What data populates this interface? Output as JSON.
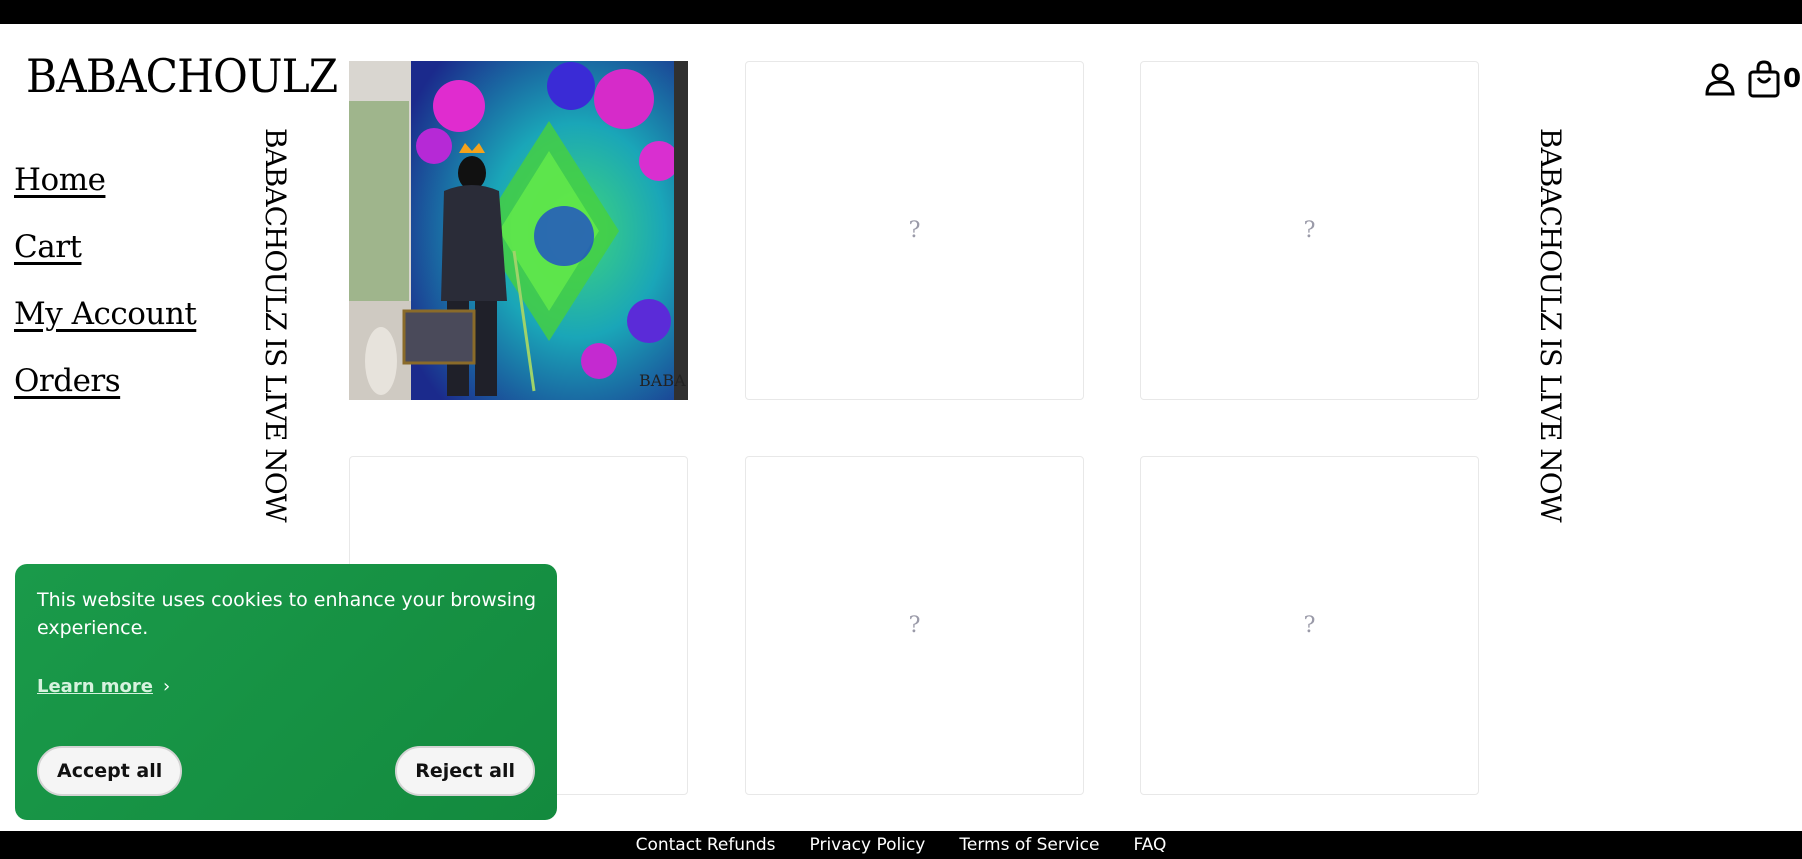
{
  "brand": {
    "logo_text": "BABACHOULZ"
  },
  "nav": {
    "items": [
      "Home",
      "Cart",
      "My Account",
      "Orders"
    ]
  },
  "marquee": {
    "text": "BABACHOULZ IS LIVE NOW"
  },
  "header": {
    "cart_count": "0",
    "icons": [
      "account-icon",
      "shopping-bag-icon"
    ]
  },
  "products": {
    "placeholder_glyph": "?",
    "tiles": [
      {
        "type": "image",
        "artwork": "crowned gorilla in suit with briefcase before neon roses and star backdrop",
        "signature": "BABA"
      },
      {
        "type": "placeholder"
      },
      {
        "type": "placeholder"
      },
      {
        "type": "placeholder"
      },
      {
        "type": "placeholder"
      },
      {
        "type": "placeholder"
      }
    ]
  },
  "cookie": {
    "message": "This website uses cookies to enhance your browsing experience.",
    "learn_more": "Learn more",
    "accept": "Accept all",
    "reject": "Reject all",
    "color": "#179345"
  },
  "footer": {
    "links": [
      "Contact",
      "Refunds",
      "Privacy Policy",
      "Terms of Service",
      "FAQ"
    ]
  }
}
